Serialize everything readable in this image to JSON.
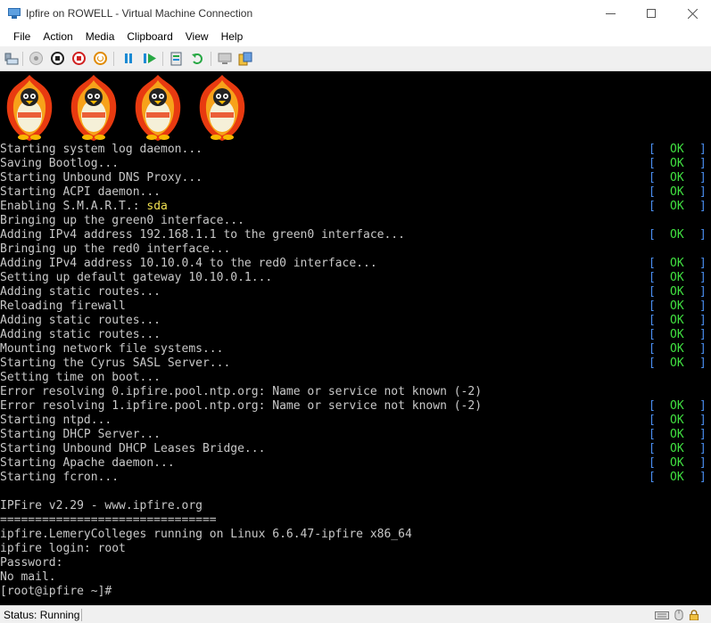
{
  "window": {
    "title": "Ipfire on ROWELL - Virtual Machine Connection",
    "controls": [
      "minimize-icon",
      "maximize-icon",
      "close-icon"
    ]
  },
  "menubar": {
    "items": [
      {
        "label": "File"
      },
      {
        "label": "Action"
      },
      {
        "label": "Media"
      },
      {
        "label": "Clipboard"
      },
      {
        "label": "View"
      },
      {
        "label": "Help"
      }
    ]
  },
  "toolbar": {
    "buttons": [
      {
        "name": "ctrl-alt-del-icon"
      },
      {
        "name": "start-icon"
      },
      {
        "name": "turn-off-icon"
      },
      {
        "name": "shut-down-icon"
      },
      {
        "name": "power-icon"
      },
      {
        "name": "pause-icon"
      },
      {
        "name": "resume-icon"
      },
      {
        "name": "checkpoint-icon"
      },
      {
        "name": "revert-icon"
      },
      {
        "name": "enhanced-session-icon"
      },
      {
        "name": "share-icon"
      }
    ]
  },
  "console": {
    "mascot_count": 4,
    "ok_label": "OK",
    "lines": [
      {
        "text": "Starting system log daemon...",
        "status": true
      },
      {
        "text": "Saving Bootlog...",
        "status": true
      },
      {
        "text": "Starting Unbound DNS Proxy...",
        "status": true
      },
      {
        "text": "Starting ACPI daemon...",
        "status": true
      },
      {
        "text": "Enabling S.M.A.R.T.: ",
        "highlight": "sda",
        "status": true
      },
      {
        "text": "Bringing up the green0 interface...",
        "status": false
      },
      {
        "text": "Adding IPv4 address 192.168.1.1 to the green0 interface...",
        "status": true
      },
      {
        "text": "Bringing up the red0 interface...",
        "status": false
      },
      {
        "text": "Adding IPv4 address 10.10.0.4 to the red0 interface...",
        "status": true
      },
      {
        "text": "Setting up default gateway 10.10.0.1...",
        "status": true
      },
      {
        "text": "Adding static routes...",
        "status": true
      },
      {
        "text": "Reloading firewall",
        "status": true
      },
      {
        "text": "Adding static routes...",
        "status": true
      },
      {
        "text": "Adding static routes...",
        "status": true
      },
      {
        "text": "Mounting network file systems...",
        "status": true
      },
      {
        "text": "Starting the Cyrus SASL Server...",
        "status": true
      },
      {
        "text": "Setting time on boot...",
        "status": false
      },
      {
        "text": "Error resolving 0.ipfire.pool.ntp.org: Name or service not known (-2)",
        "status": false
      },
      {
        "text": "Error resolving 1.ipfire.pool.ntp.org: Name or service not known (-2)",
        "status": true
      },
      {
        "text": "Starting ntpd...",
        "status": true
      },
      {
        "text": "Starting DHCP Server...",
        "status": true
      },
      {
        "text": "Starting Unbound DHCP Leases Bridge...",
        "status": true
      },
      {
        "text": "Starting Apache daemon...",
        "status": true
      },
      {
        "text": "Starting fcron...",
        "status": true
      },
      {
        "text": "",
        "status": false
      },
      {
        "text": "IPFire v2.29 - www.ipfire.org",
        "status": false
      },
      {
        "text": "===============================",
        "status": false
      },
      {
        "text": "ipfire.LemeryColleges running on Linux 6.6.47-ipfire x86_64",
        "status": false
      },
      {
        "text": "ipfire login: root",
        "status": false
      },
      {
        "text": "Password:",
        "status": false
      },
      {
        "text": "No mail.",
        "status": false
      },
      {
        "text": "[root@ipfire ~]#",
        "status": false
      }
    ]
  },
  "statusbar": {
    "status_text": "Status: Running"
  }
}
